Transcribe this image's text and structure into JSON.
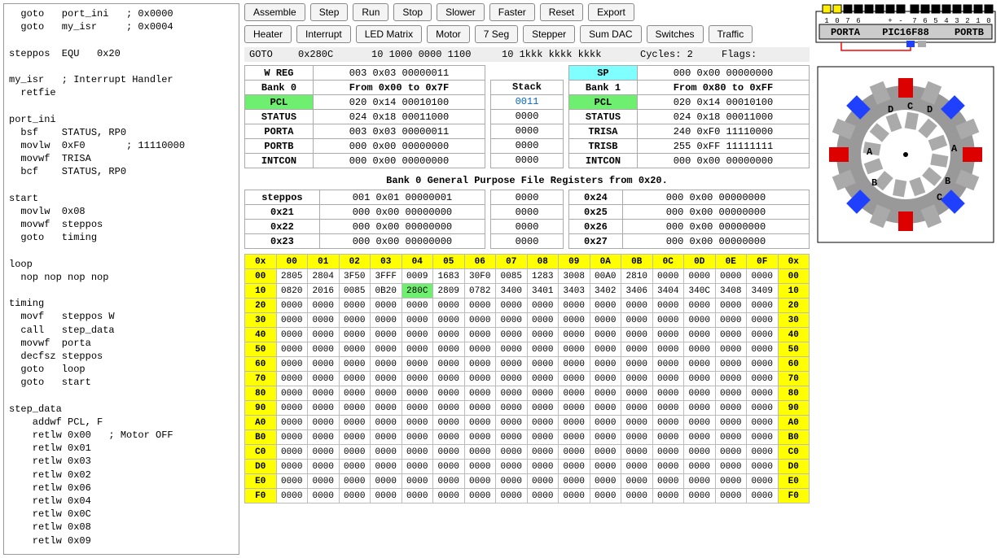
{
  "code": "  goto   port_ini   ; 0x0000\n  goto   my_isr     ; 0x0004\n\nsteppos  EQU   0x20\n\nmy_isr   ; Interrupt Handler\n  retfie\n\nport_ini\n  bsf    STATUS, RP0\n  movlw  0xF0       ; 11110000\n  movwf  TRISA\n  bcf    STATUS, RP0\n\nstart\n  movlw  0x08\n  movwf  steppos\n  goto   timing\n\nloop\n  nop nop nop nop\n\ntiming\n  movf   steppos W\n  call   step_data\n  movwf  porta\n  decfsz steppos\n  goto   loop\n  goto   start\n\nstep_data\n    addwf PCL, F\n    retlw 0x00   ; Motor OFF\n    retlw 0x01\n    retlw 0x03\n    retlw 0x02\n    retlw 0x06\n    retlw 0x04\n    retlw 0x0C\n    retlw 0x08\n    retlw 0x09",
  "buttons_row1": [
    "Assemble",
    "Step",
    "Run",
    "Stop",
    "Slower",
    "Faster",
    "Reset",
    "Export"
  ],
  "buttons_row2": [
    "Heater",
    "Interrupt",
    "LED Matrix",
    "Motor",
    "7 Seg",
    "Stepper",
    "Sum DAC",
    "Switches",
    "Traffic"
  ],
  "status": {
    "op": "GOTO",
    "addr": "0x280C",
    "bin": "10 1000 0000 1100",
    "pat": "10 1kkk kkkk kkkk",
    "cycles": "Cycles: 2",
    "flags": "Flags:"
  },
  "bank0_header": "Bank 0",
  "bank0_range": "From 0x00 to 0x7F",
  "bank1_header": "Bank 1",
  "bank1_range": "From 0x80 to 0xFF",
  "wreg_label": "W REG",
  "wreg_val": "003 0x03 00000011",
  "sp_label": "SP",
  "sp_val": "000 0x00 00000000",
  "regs0": [
    {
      "name": "PCL",
      "val": "020 0x14 00010100",
      "hl": true
    },
    {
      "name": "STATUS",
      "val": "024 0x18 00011000"
    },
    {
      "name": "PORTA",
      "val": "003 0x03 00000011"
    },
    {
      "name": "PORTB",
      "val": "000 0x00 00000000"
    },
    {
      "name": "INTCON",
      "val": "000 0x00 00000000"
    }
  ],
  "regs1": [
    {
      "name": "PCL",
      "val": "020 0x14 00010100",
      "hl": true
    },
    {
      "name": "STATUS",
      "val": "024 0x18 00011000"
    },
    {
      "name": "TRISA",
      "val": "240 0xF0 11110000"
    },
    {
      "name": "TRISB",
      "val": "255 0xFF 11111111"
    },
    {
      "name": "INTCON",
      "val": "000 0x00 00000000"
    }
  ],
  "stack_label": "Stack",
  "stack": [
    "0011",
    "0000",
    "0000",
    "0000",
    "0000"
  ],
  "gpr_title": "Bank 0 General Purpose File Registers from 0x20.",
  "gpr_left": [
    {
      "name": "steppos",
      "val": "001 0x01 00000001"
    },
    {
      "name": "0x21",
      "val": "000 0x00 00000000"
    },
    {
      "name": "0x22",
      "val": "000 0x00 00000000"
    },
    {
      "name": "0x23",
      "val": "000 0x00 00000000"
    }
  ],
  "gpr_mid": [
    "0000",
    "0000",
    "0000",
    "0000"
  ],
  "gpr_right": [
    {
      "name": "0x24",
      "val": "000 0x00 00000000"
    },
    {
      "name": "0x25",
      "val": "000 0x00 00000000"
    },
    {
      "name": "0x26",
      "val": "000 0x00 00000000"
    },
    {
      "name": "0x27",
      "val": "000 0x00 00000000"
    }
  ],
  "mem_cols": [
    "0x",
    "00",
    "01",
    "02",
    "03",
    "04",
    "05",
    "06",
    "07",
    "08",
    "09",
    "0A",
    "0B",
    "0C",
    "0D",
    "0E",
    "0F",
    "0x"
  ],
  "mem_rows": [
    {
      "h": "00",
      "c": [
        "2805",
        "2804",
        "3F50",
        "3FFF",
        "0009",
        "1683",
        "30F0",
        "0085",
        "1283",
        "3008",
        "00A0",
        "2810",
        "0000",
        "0000",
        "0000",
        "0000"
      ]
    },
    {
      "h": "10",
      "c": [
        "0820",
        "2016",
        "0085",
        "0B20",
        "280C",
        "2809",
        "0782",
        "3400",
        "3401",
        "3403",
        "3402",
        "3406",
        "3404",
        "340C",
        "3408",
        "3409"
      ],
      "pc": 4
    },
    {
      "h": "20",
      "c": [
        "0000",
        "0000",
        "0000",
        "0000",
        "0000",
        "0000",
        "0000",
        "0000",
        "0000",
        "0000",
        "0000",
        "0000",
        "0000",
        "0000",
        "0000",
        "0000"
      ]
    },
    {
      "h": "30",
      "c": [
        "0000",
        "0000",
        "0000",
        "0000",
        "0000",
        "0000",
        "0000",
        "0000",
        "0000",
        "0000",
        "0000",
        "0000",
        "0000",
        "0000",
        "0000",
        "0000"
      ]
    },
    {
      "h": "40",
      "c": [
        "0000",
        "0000",
        "0000",
        "0000",
        "0000",
        "0000",
        "0000",
        "0000",
        "0000",
        "0000",
        "0000",
        "0000",
        "0000",
        "0000",
        "0000",
        "0000"
      ]
    },
    {
      "h": "50",
      "c": [
        "0000",
        "0000",
        "0000",
        "0000",
        "0000",
        "0000",
        "0000",
        "0000",
        "0000",
        "0000",
        "0000",
        "0000",
        "0000",
        "0000",
        "0000",
        "0000"
      ]
    },
    {
      "h": "60",
      "c": [
        "0000",
        "0000",
        "0000",
        "0000",
        "0000",
        "0000",
        "0000",
        "0000",
        "0000",
        "0000",
        "0000",
        "0000",
        "0000",
        "0000",
        "0000",
        "0000"
      ]
    },
    {
      "h": "70",
      "c": [
        "0000",
        "0000",
        "0000",
        "0000",
        "0000",
        "0000",
        "0000",
        "0000",
        "0000",
        "0000",
        "0000",
        "0000",
        "0000",
        "0000",
        "0000",
        "0000"
      ]
    },
    {
      "h": "80",
      "c": [
        "0000",
        "0000",
        "0000",
        "0000",
        "0000",
        "0000",
        "0000",
        "0000",
        "0000",
        "0000",
        "0000",
        "0000",
        "0000",
        "0000",
        "0000",
        "0000"
      ]
    },
    {
      "h": "90",
      "c": [
        "0000",
        "0000",
        "0000",
        "0000",
        "0000",
        "0000",
        "0000",
        "0000",
        "0000",
        "0000",
        "0000",
        "0000",
        "0000",
        "0000",
        "0000",
        "0000"
      ]
    },
    {
      "h": "A0",
      "c": [
        "0000",
        "0000",
        "0000",
        "0000",
        "0000",
        "0000",
        "0000",
        "0000",
        "0000",
        "0000",
        "0000",
        "0000",
        "0000",
        "0000",
        "0000",
        "0000"
      ]
    },
    {
      "h": "B0",
      "c": [
        "0000",
        "0000",
        "0000",
        "0000",
        "0000",
        "0000",
        "0000",
        "0000",
        "0000",
        "0000",
        "0000",
        "0000",
        "0000",
        "0000",
        "0000",
        "0000"
      ]
    },
    {
      "h": "C0",
      "c": [
        "0000",
        "0000",
        "0000",
        "0000",
        "0000",
        "0000",
        "0000",
        "0000",
        "0000",
        "0000",
        "0000",
        "0000",
        "0000",
        "0000",
        "0000",
        "0000"
      ]
    },
    {
      "h": "D0",
      "c": [
        "0000",
        "0000",
        "0000",
        "0000",
        "0000",
        "0000",
        "0000",
        "0000",
        "0000",
        "0000",
        "0000",
        "0000",
        "0000",
        "0000",
        "0000",
        "0000"
      ]
    },
    {
      "h": "E0",
      "c": [
        "0000",
        "0000",
        "0000",
        "0000",
        "0000",
        "0000",
        "0000",
        "0000",
        "0000",
        "0000",
        "0000",
        "0000",
        "0000",
        "0000",
        "0000",
        "0000"
      ]
    },
    {
      "h": "F0",
      "c": [
        "0000",
        "0000",
        "0000",
        "0000",
        "0000",
        "0000",
        "0000",
        "0000",
        "0000",
        "0000",
        "0000",
        "0000",
        "0000",
        "0000",
        "0000",
        "0000"
      ]
    }
  ],
  "chip": {
    "left": "PORTA",
    "mid": "PIC16F88",
    "right": "PORTB",
    "pins_l": [
      "1",
      "0",
      "7",
      "6",
      "",
      "",
      "+",
      "-"
    ],
    "pins_r": [
      "7",
      "6",
      "5",
      "4",
      "3",
      "2",
      "1",
      "0"
    ]
  },
  "motor_labels": [
    "A",
    "B",
    "C",
    "D",
    "A",
    "B",
    "C",
    "D"
  ]
}
